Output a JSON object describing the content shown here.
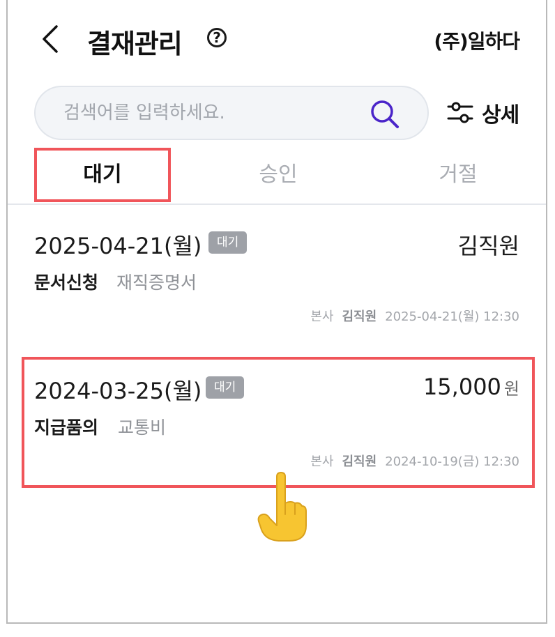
{
  "header": {
    "title": "결재관리",
    "help_icon": "question-circle-icon",
    "help_glyph": "?",
    "company": "(주)일하다"
  },
  "search": {
    "placeholder": "검색어를 입력하세요.",
    "value": "",
    "icon": "search-icon",
    "icon_color": "#4a24c9"
  },
  "filter": {
    "label": "상세",
    "icon": "sliders-icon"
  },
  "tabs": [
    {
      "label": "대기",
      "active": true
    },
    {
      "label": "승인",
      "active": false
    },
    {
      "label": "거절",
      "active": false
    }
  ],
  "cards": [
    {
      "date": "2025-04-21(월)",
      "status": "대기",
      "right_text": "김직원",
      "type": "문서신청",
      "subtype": "재직증명서",
      "meta_branch": "본사",
      "meta_name": "김직원",
      "meta_datetime": "2025-04-21(월) 12:30"
    },
    {
      "date": "2024-03-25(월)",
      "status": "대기",
      "amount": "15,000",
      "amount_unit": "원",
      "type": "지급품의",
      "subtype": "교통비",
      "meta_branch": "본사",
      "meta_name": "김직원",
      "meta_datetime": "2024-10-19(금) 12:30"
    }
  ],
  "colors": {
    "accent": "#4a24c9",
    "highlight": "#f0555a",
    "badge": "#9ea1a7",
    "search_bg": "#f3f5f8"
  },
  "pointer_icon": "pointing-hand-icon"
}
